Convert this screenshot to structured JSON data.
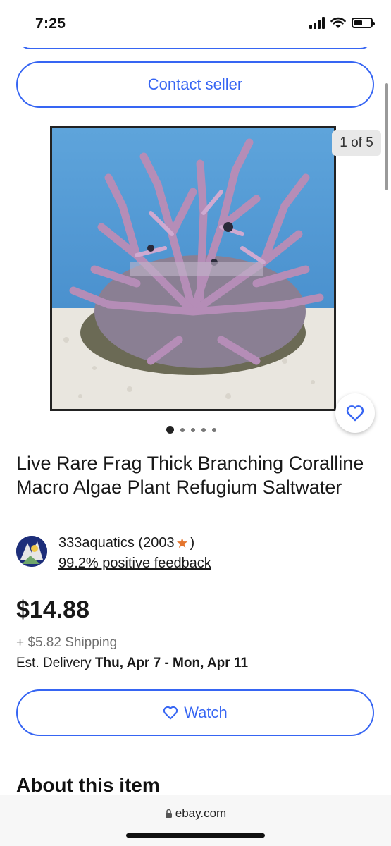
{
  "status_bar": {
    "time": "7:25",
    "icons": [
      "signal-icon",
      "wifi-icon",
      "battery-icon"
    ]
  },
  "buttons": {
    "contact_seller": "Contact seller",
    "watch": "Watch"
  },
  "gallery": {
    "counter": "1 of 5",
    "total_images": 5,
    "current_index": 1
  },
  "listing": {
    "title": "Live Rare Frag Thick Branching Coralline Macro Algae Plant Refugium Saltwater",
    "price": "$14.88",
    "shipping": "+ $5.82 Shipping",
    "delivery_label": "Est. Delivery ",
    "delivery_dates": "Thu, Apr 7 - Mon, Apr 11"
  },
  "seller": {
    "name": "333aquatics (2003 ",
    "name_suffix": ")",
    "feedback": "99.2% positive feedback"
  },
  "sections": {
    "about_heading": "About this item"
  },
  "browser": {
    "url": "ebay.com"
  },
  "colors": {
    "accent": "#3665f3",
    "star": "#e4752d",
    "text": "#191919",
    "muted": "#707070"
  }
}
